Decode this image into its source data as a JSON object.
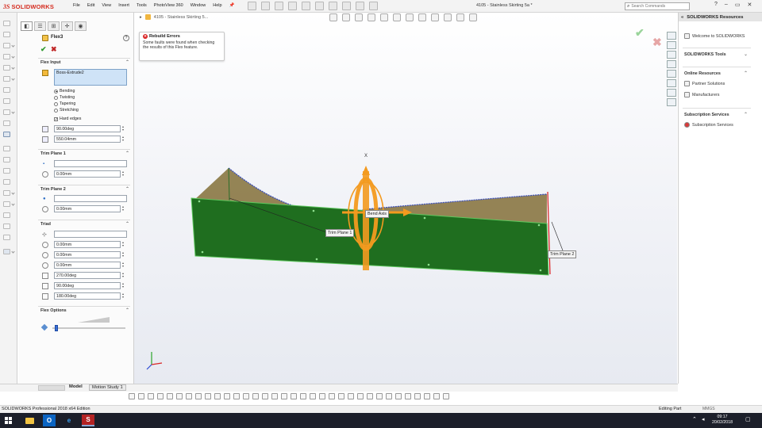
{
  "app": {
    "logo_text": "SOLIDWORKS",
    "document_title": "4105 - Stainless Skirting 5a *",
    "menus": [
      "File",
      "Edit",
      "View",
      "Insert",
      "Tools",
      "PhotoView 360",
      "Window",
      "Help"
    ],
    "search_placeholder": "Search Commands",
    "window_controls": [
      "?",
      "–",
      "▭",
      "✕"
    ]
  },
  "property_manager": {
    "feature_title": "Flex3",
    "ok": "✔",
    "cancel": "✖",
    "help": "?",
    "flex_input": {
      "heading": "Flex Input",
      "selected_body": "Boss-Extrude2",
      "modes": [
        {
          "label": "Bending",
          "checked": true
        },
        {
          "label": "Twisting",
          "checked": false
        },
        {
          "label": "Tapering",
          "checked": false
        },
        {
          "label": "Stretching",
          "checked": false
        }
      ],
      "hard_edges_label": "Hard edges",
      "hard_edges_checked": true,
      "angle": "90.00deg",
      "radius": "550.04mm"
    },
    "trim_plane_1": {
      "heading": "Trim Plane 1",
      "reference": "",
      "offset": "0.00mm"
    },
    "trim_plane_2": {
      "heading": "Trim Plane 2",
      "reference": "",
      "offset": "0.00mm"
    },
    "triad": {
      "heading": "Triad",
      "reference": "",
      "x": "0.00mm",
      "y": "0.00mm",
      "z": "0.00mm",
      "rot_x": "270.00deg",
      "rot_y": "90.00deg",
      "rot_z": "180.00deg"
    },
    "flex_options": {
      "heading": "Flex Options",
      "accuracy": 0.03
    },
    "collapse": "⌃"
  },
  "graphics": {
    "breadcrumb": "4105 - Stainless Skirting 5...",
    "error_title": "Rebuild Errors",
    "error_message": "Some faults were found when checking the results of this Flex feature.",
    "confirm_ok": "✔",
    "confirm_cancel": "✖",
    "labels": {
      "bend_axis": "Bend Axis",
      "trim_plane_1": "Trim Plane 1",
      "trim_plane_2": "Trim Plane 2",
      "triad_x": "X"
    },
    "colors": {
      "body_green": "#1f6e1f",
      "curved_surface": "#8c7a47",
      "triad_orange": "#f39a1f",
      "edge_blue": "#3b4fb8",
      "trim_red": "#d91c1c"
    }
  },
  "task_pane": {
    "title": "SOLIDWORKS Resources",
    "welcome": "Welcome to SOLIDWORKS",
    "tools_heading": "SOLIDWORKS Tools",
    "online_heading": "Online Resources",
    "online_items": [
      "Partner Solutions",
      "Manufacturers"
    ],
    "subscription_heading": "Subscription Services",
    "subscription_items": [
      "Subscription Services"
    ]
  },
  "bottom": {
    "tab_model": "Model",
    "tab_motion": "Motion Study 1"
  },
  "status": {
    "edition": "SOLIDWORKS Professional 2018 x64 Edition",
    "mode": "Editing Part",
    "units": "MMGS"
  },
  "taskbar": {
    "time": "09:17",
    "date": "20/02/2018",
    "apps": [
      "outlook-app",
      "edge-app",
      "solidworks-app"
    ]
  }
}
